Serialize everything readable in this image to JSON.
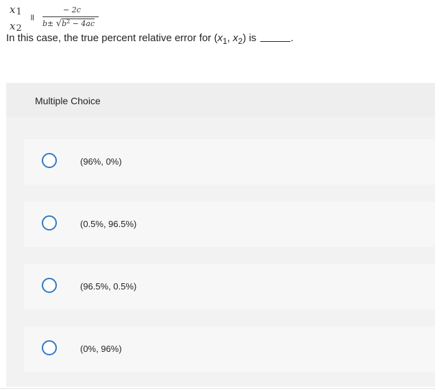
{
  "formula": {
    "lhs_top": "x",
    "lhs_top_sub": "1",
    "lhs_bottom": "x",
    "lhs_bottom_sub": "2",
    "equals": "=",
    "numerator": "− 2c",
    "denominator_prefix": "b±",
    "radical": "√",
    "radicand_b": "b",
    "radicand_exp": "2",
    "radicand_rest": " − 4ac"
  },
  "question": {
    "text_before": "In this case, the true percent relative error for (",
    "var1": "x",
    "var1_sub": "1",
    "sep": ", ",
    "var2": "x",
    "var2_sub": "2",
    "text_after": ")  is",
    "text_end": "."
  },
  "multiple_choice": {
    "title": "Multiple Choice",
    "options": [
      {
        "label": "(96%, 0%)",
        "selected": false
      },
      {
        "label": "(0.5%, 96.5%)",
        "selected": false
      },
      {
        "label": "(96.5%, 0.5%)",
        "selected": false
      },
      {
        "label": "(0%, 96%)",
        "selected": false
      }
    ]
  },
  "colors": {
    "radio_border": "#2f78c4",
    "panel_bg": "#f2f2f2",
    "option_bg": "#f7f7f7"
  }
}
